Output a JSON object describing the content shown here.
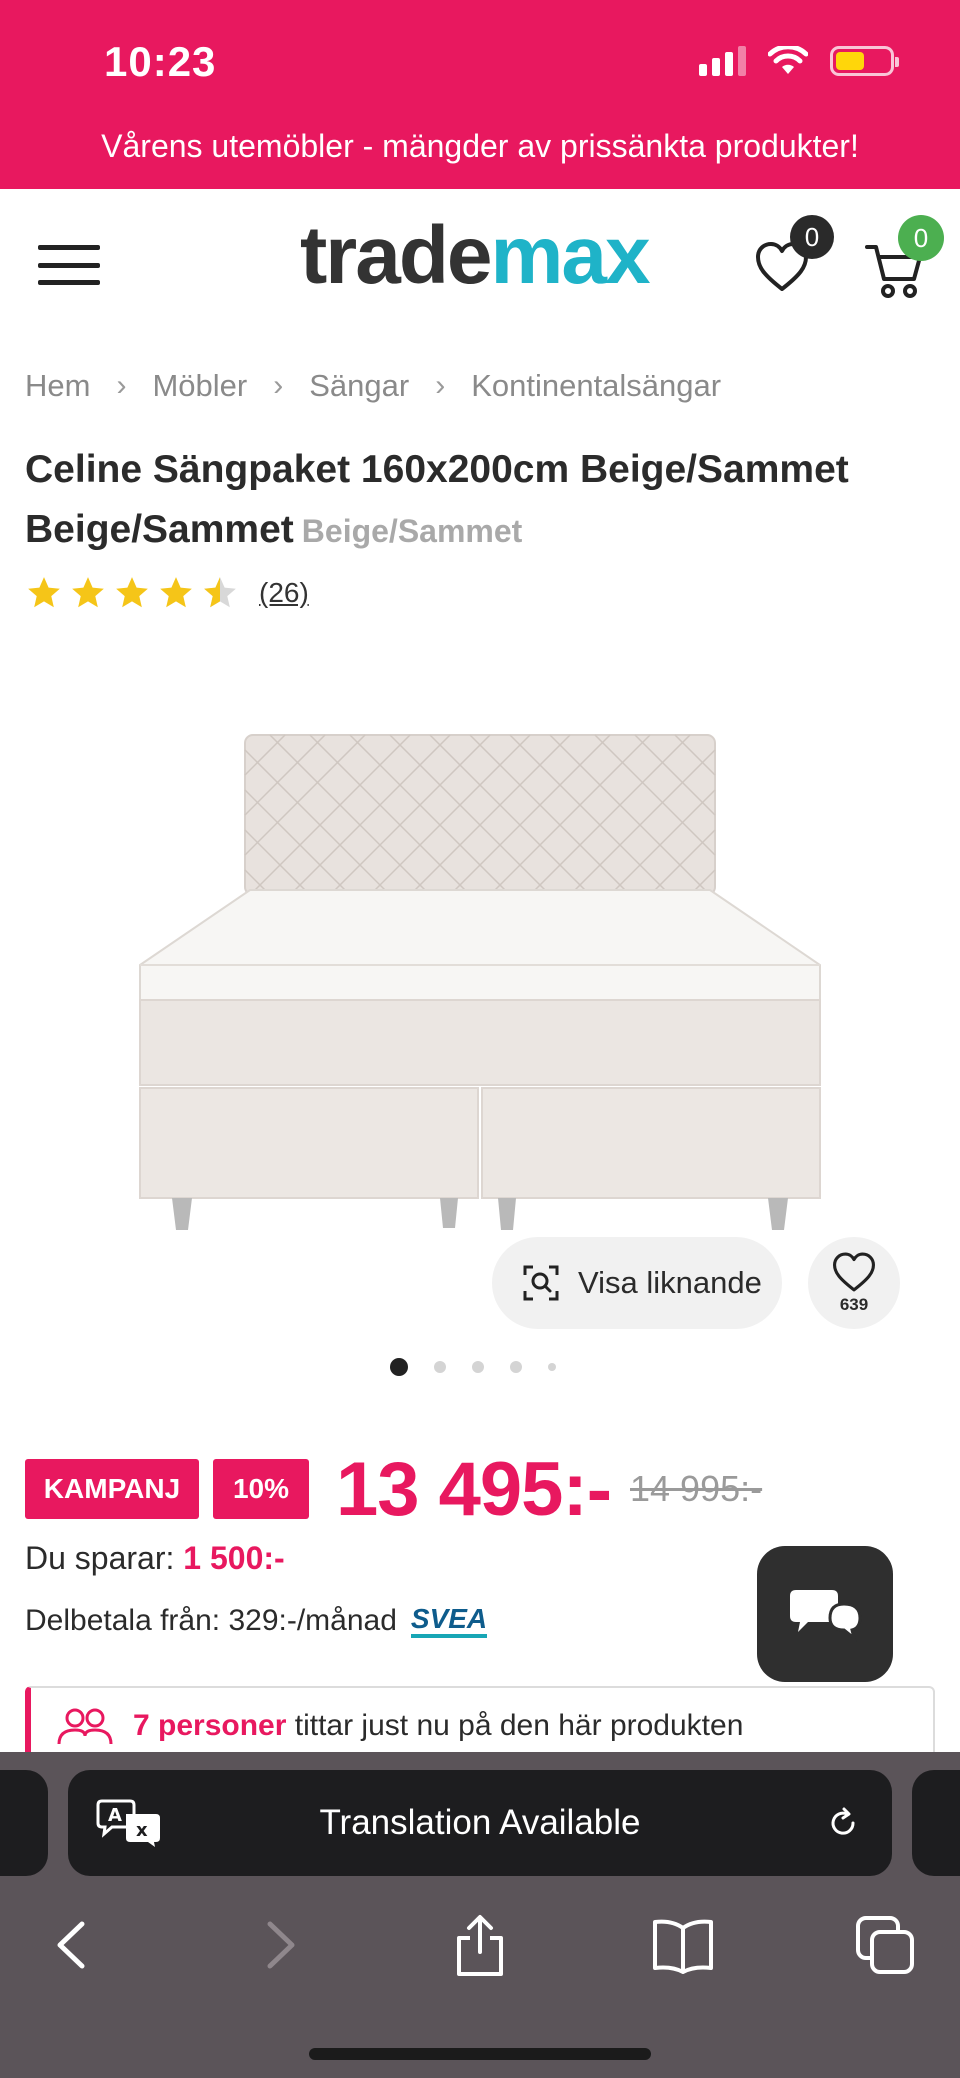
{
  "status_bar": {
    "time": "10:23"
  },
  "promo_banner": {
    "text": "Vårens utemöbler - mängder av prissänkta produkter!"
  },
  "header": {
    "logo_part1": "trade",
    "logo_part2": "max",
    "wishlist_count": "0",
    "cart_count": "0"
  },
  "breadcrumbs": [
    "Hem",
    "Möbler",
    "Sängar",
    "Kontinentalsängar"
  ],
  "product": {
    "title": "Celine Sängpaket 160x200cm Beige/Sammet Beige/Sammet",
    "variant": "Beige/Sammet",
    "rating": 4.5,
    "review_count": "(26)",
    "similar_label": "Visa liknande",
    "favorites_count": "639",
    "image_count": 5,
    "active_image": 0
  },
  "price": {
    "campaign_badge": "KAMPANJ",
    "discount_badge": "10%",
    "current": "13 495:-",
    "original": "14 995:-",
    "savings_label": "Du sparar:",
    "savings_amount": "1 500:-",
    "installment_text": "Delbetala från: 329:-/månad",
    "installment_provider": "SVEA"
  },
  "viewers": {
    "highlight": "7 personer",
    "rest": "tittar just nu på den här produkten"
  },
  "safari": {
    "translation_text": "Translation Available"
  },
  "colors": {
    "brand_pink": "#e8185f",
    "logo_teal": "#1fb3c8",
    "star_gold": "#f5c518"
  }
}
